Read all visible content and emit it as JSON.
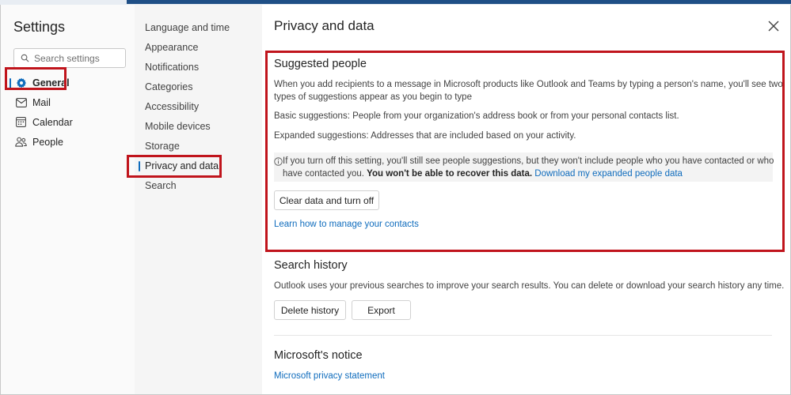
{
  "settings": {
    "title": "Settings",
    "search_placeholder": "Search settings"
  },
  "primary_nav": [
    {
      "label": "General",
      "icon": "gear-icon",
      "active": true
    },
    {
      "label": "Mail",
      "icon": "mail-icon"
    },
    {
      "label": "Calendar",
      "icon": "calendar-icon"
    },
    {
      "label": "People",
      "icon": "people-icon"
    }
  ],
  "secondary_nav": [
    {
      "label": "Language and time"
    },
    {
      "label": "Appearance"
    },
    {
      "label": "Notifications"
    },
    {
      "label": "Categories"
    },
    {
      "label": "Accessibility"
    },
    {
      "label": "Mobile devices"
    },
    {
      "label": "Storage"
    },
    {
      "label": "Privacy and data",
      "active": true
    },
    {
      "label": "Search"
    }
  ],
  "main": {
    "title": "Privacy and data",
    "suggested_people": {
      "title": "Suggested people",
      "desc_line1": "When you add recipients to a message in Microsoft products like Outlook and Teams by typing a person's name, you'll see two",
      "desc_line2": "types of suggestions appear as you begin to type",
      "basic": "Basic suggestions: People from your organization's address book or from your personal contacts list.",
      "expanded": "Expanded suggestions: Addresses that are included based on your activity.",
      "info_line1": "If you turn off this setting, you'll still see people suggestions, but they won't include people who you have contacted or who",
      "info_line2_pre": "have contacted you.",
      "info_line2_bold": "You won't be able to recover this data.",
      "info_link": "Download my expanded people data",
      "clear_button": "Clear data and turn off",
      "manage_link": "Learn how to manage your contacts"
    },
    "search_history": {
      "title": "Search history",
      "desc": "Outlook uses your previous searches to improve your search results. You can delete or download your search history any time.",
      "delete_button": "Delete history",
      "export_button": "Export"
    },
    "notice": {
      "title": "Microsoft's notice",
      "link": "Microsoft privacy statement"
    }
  },
  "colors": {
    "accent": "#0f6cbd",
    "highlight_border": "#c0141c",
    "top_bar": "#1f4f86"
  }
}
